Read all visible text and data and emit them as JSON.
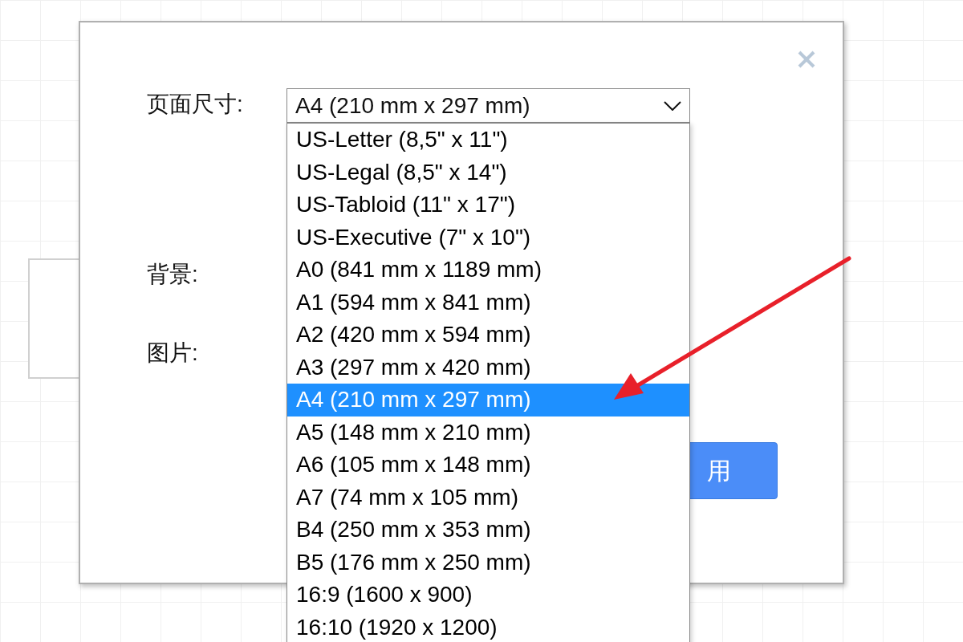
{
  "dialog": {
    "fields": [
      {
        "label": "页面尺寸:",
        "kind": "select",
        "value": "A4 (210 mm x 297 mm)"
      },
      {
        "label": "背景:",
        "kind": "plain"
      },
      {
        "label": "图片:",
        "kind": "plain"
      }
    ],
    "apply_button": "用",
    "dropdown": {
      "options": [
        {
          "label": "US-Letter (8,5\" x 11\")",
          "selected": false
        },
        {
          "label": "US-Legal (8,5\" x 14\")",
          "selected": false
        },
        {
          "label": "US-Tabloid (11\" x 17\")",
          "selected": false
        },
        {
          "label": "US-Executive (7\" x 10\")",
          "selected": false
        },
        {
          "label": "A0 (841 mm x 1189 mm)",
          "selected": false
        },
        {
          "label": "A1 (594 mm x 841 mm)",
          "selected": false
        },
        {
          "label": "A2 (420 mm x 594 mm)",
          "selected": false
        },
        {
          "label": "A3 (297 mm x 420 mm)",
          "selected": false
        },
        {
          "label": "A4 (210 mm x 297 mm)",
          "selected": true
        },
        {
          "label": "A5 (148 mm x 210 mm)",
          "selected": false
        },
        {
          "label": "A6 (105 mm x 148 mm)",
          "selected": false
        },
        {
          "label": "A7 (74 mm x 105 mm)",
          "selected": false
        },
        {
          "label": "B4 (250 mm x 353 mm)",
          "selected": false
        },
        {
          "label": "B5 (176 mm x 250 mm)",
          "selected": false
        },
        {
          "label": "16:9 (1600 x 900)",
          "selected": false
        },
        {
          "label": "16:10 (1920 x 1200)",
          "selected": false
        }
      ]
    }
  }
}
